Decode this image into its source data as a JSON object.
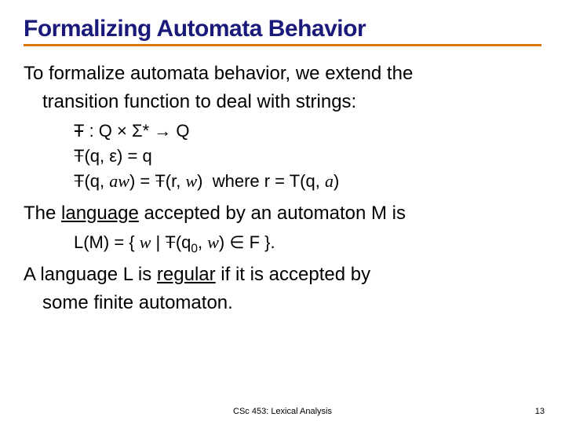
{
  "title": "Formalizing Automata Behavior",
  "p1a": "To formalize automata behavior, we extend the",
  "p1b": "transition function to deal with strings:",
  "f1_pre": " : Q × Σ* → Q",
  "f2_pre": "(q, ε) = q",
  "f3_a": "(q, ",
  "f3_aw": "aw",
  "f3_b": ") =  ",
  "f3_c": "(r, ",
  "f3_w": "w",
  "f3_d": ")  where r = T(q, ",
  "f3_av": "a",
  "f3_e": ")",
  "p2a": "The ",
  "p2word": "language",
  "p2b": " accepted by an automaton M is",
  "lang_a": "L(M) = { ",
  "lang_w1": "w",
  "lang_b": " | ",
  "lang_c": "(q",
  "lang_sub": "0",
  "lang_d": ", ",
  "lang_w2": "w",
  "lang_e": ") ∈ F }.",
  "p3a": "A language L is ",
  "p3word": "regular",
  "p3b": " if it is accepted by",
  "p3c": "some finite automaton.",
  "footer_center": "CSc 453: Lexical Analysis",
  "footer_right": "13"
}
